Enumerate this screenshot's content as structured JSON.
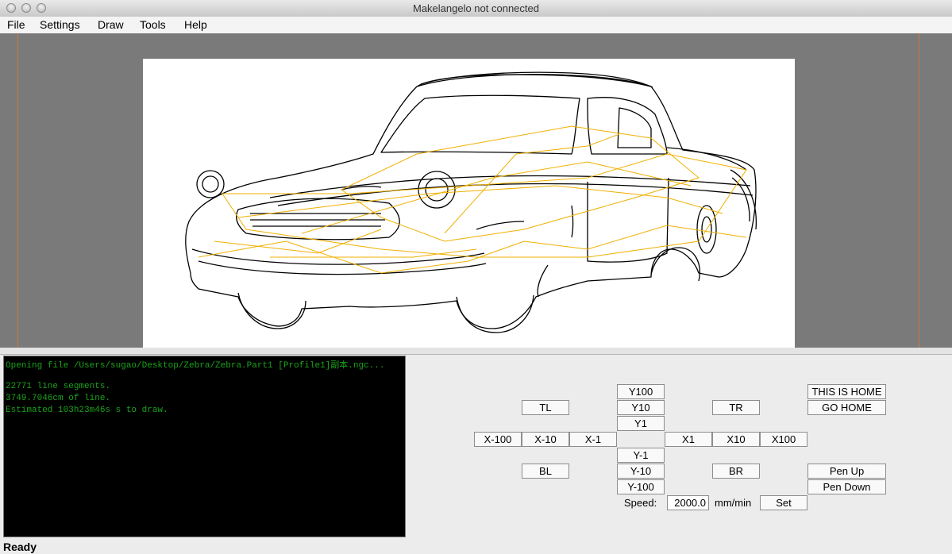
{
  "window": {
    "title": "Makelangelo not connected"
  },
  "menu": [
    "File",
    "Settings",
    "Draw",
    "Tools",
    "Help"
  ],
  "log": [
    "Opening file /Users/sugao/Desktop/Zebra/Zebra.Part1 [Profile1]副本.ngc...",
    "",
    "22771 line segments.",
    "3749.7046cm of line.",
    "Estimated 103h23m46s s to draw."
  ],
  "controls": {
    "y100": "Y100",
    "y10": "Y10",
    "y1": "Y1",
    "tl": "TL",
    "tr": "TR",
    "xm100": "X-100",
    "xm10": "X-10",
    "xm1": "X-1",
    "x1": "X1",
    "x10": "X10",
    "x100": "X100",
    "ym1": "Y-1",
    "ym10": "Y-10",
    "ym100": "Y-100",
    "bl": "BL",
    "br": "BR",
    "this_is_home": "THIS IS HOME",
    "go_home": "GO HOME",
    "pen_up": "Pen Up",
    "pen_down": "Pen Down",
    "speed_label": "Speed:",
    "speed_value": "2000.0",
    "speed_unit": "mm/min",
    "set": "Set"
  },
  "status": "Ready",
  "colors": {
    "log_text": "#1aa31a",
    "travel_lines": "#f0b000",
    "guide": "#c87a3a"
  }
}
